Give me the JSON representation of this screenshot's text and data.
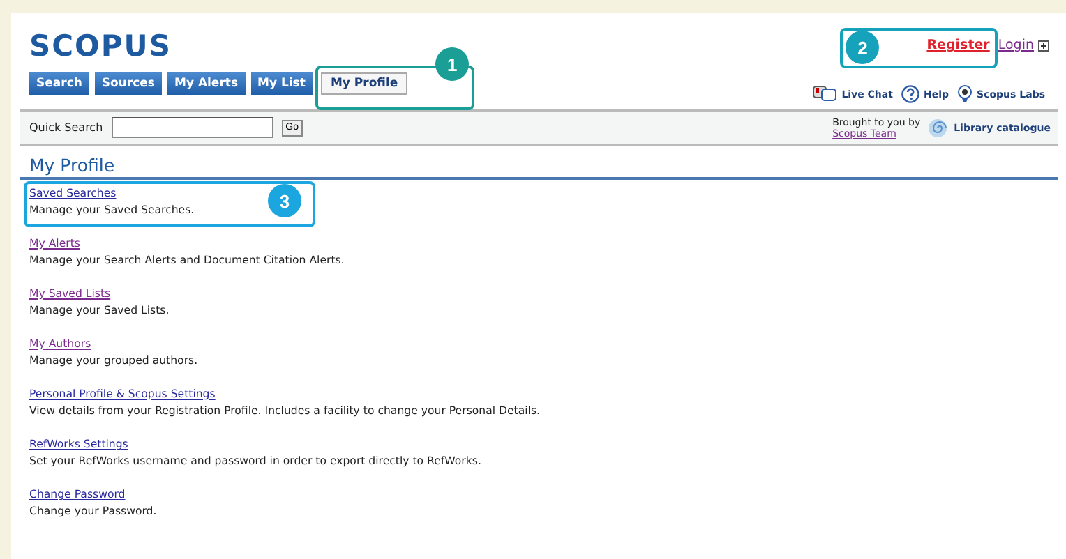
{
  "logo": {
    "text": "SCOPUS"
  },
  "tabs": [
    {
      "label": "Search",
      "selected": false
    },
    {
      "label": "Sources",
      "selected": false
    },
    {
      "label": "My Alerts",
      "selected": false
    },
    {
      "label": "My List",
      "selected": false
    },
    {
      "label": "My Profile",
      "selected": true
    }
  ],
  "account_links": [
    {
      "label": "Register",
      "kind": "register"
    },
    {
      "label": "Login",
      "kind": "login"
    }
  ],
  "tools": [
    {
      "label": "Live Chat",
      "kind": "chat"
    },
    {
      "label": "Help",
      "kind": "help"
    },
    {
      "label": "Scopus Labs",
      "kind": "labs"
    }
  ],
  "quick_search": {
    "label": "Quick Search",
    "button": "Go"
  },
  "brought_by": {
    "text": "Brought to you by",
    "link": "Scopus Team",
    "library": "Library catalogue"
  },
  "page_title": "My Profile",
  "items": [
    {
      "link": "Saved Searches",
      "visited": false,
      "description": "Manage your Saved Searches."
    },
    {
      "link": "My Alerts",
      "visited": true,
      "description": "Manage your Search Alerts and Document Citation Alerts."
    },
    {
      "link": "My Saved Lists",
      "visited": true,
      "description": "Manage your Saved Lists."
    },
    {
      "link": "My Authors",
      "visited": true,
      "description": "Manage your grouped authors."
    },
    {
      "link": "Personal Profile & Scopus Settings",
      "visited": false,
      "description": "View details from your Registration Profile. Includes a facility to change your Personal Details."
    },
    {
      "link": "RefWorks Settings",
      "visited": false,
      "description": "Set your RefWorks username and password in order to export directly to RefWorks."
    },
    {
      "link": "Change Password",
      "visited": false,
      "description": "Change your Password."
    }
  ],
  "callouts": [
    {
      "number": "1",
      "kind": "tab"
    },
    {
      "number": "2",
      "kind": "account"
    },
    {
      "number": "3",
      "kind": "item"
    }
  ]
}
